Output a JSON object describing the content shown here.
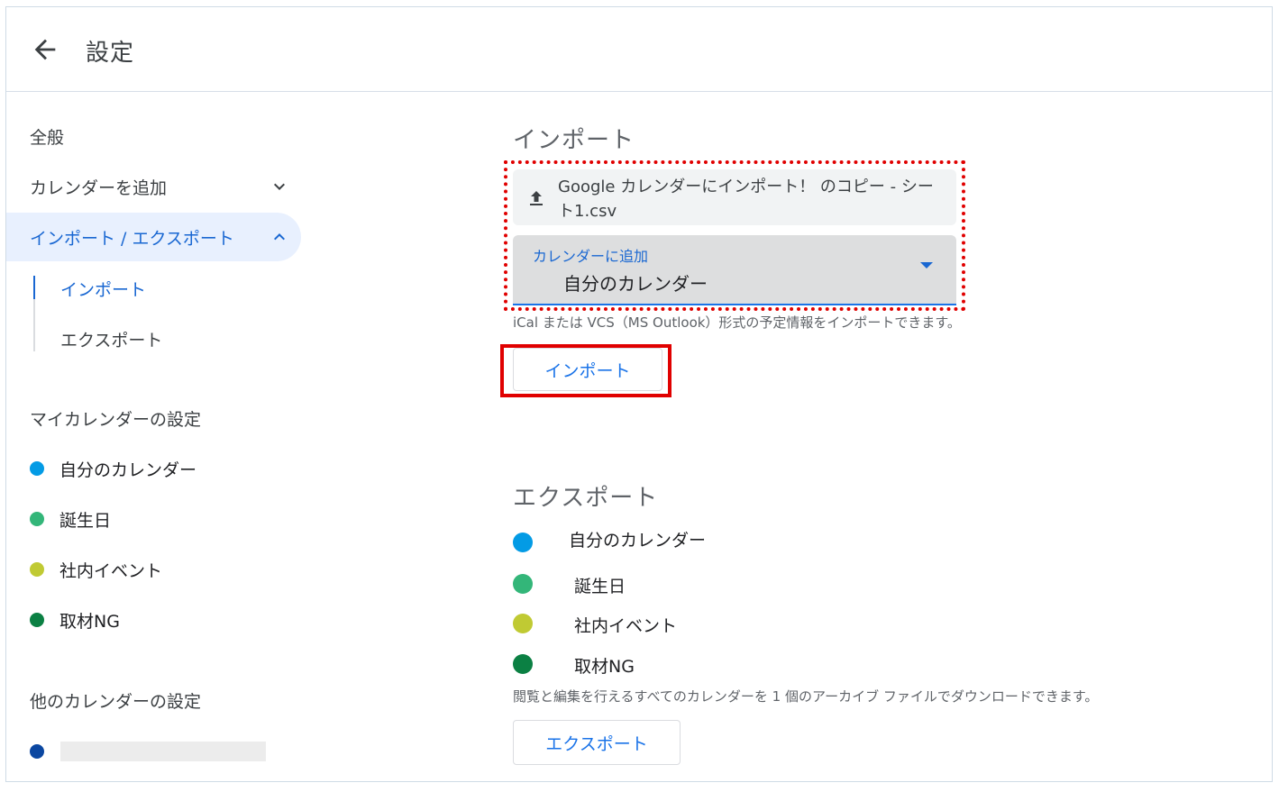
{
  "header": {
    "back_icon": "arrow-back-icon",
    "title": "設定"
  },
  "sidebar": {
    "general": "全般",
    "add_calendar": "カレンダーを追加",
    "import_export": "インポート / エクスポート",
    "sub_import": "インポート",
    "sub_export": "エクスポート",
    "my_calendars_title": "マイカレンダーの設定",
    "my_calendars": [
      {
        "label": "自分のカレンダー",
        "color": "#039be5"
      },
      {
        "label": "誕生日",
        "color": "#33b679"
      },
      {
        "label": "社内イベント",
        "color": "#c0ca33"
      },
      {
        "label": "取材NG",
        "color": "#0b8043"
      }
    ],
    "other_calendars_title": "他のカレンダーの設定",
    "other_calendar_color": "#0b47a1"
  },
  "import": {
    "title": "インポート",
    "file_name": "Google カレンダーにインポート！ のコピー - シート1.csv",
    "select_label": "カレンダーに追加",
    "select_value": "自分のカレンダー",
    "hint": "iCal または VCS（MS Outlook）形式の予定情報をインポートできます。",
    "button": "インポート"
  },
  "export": {
    "title": "エクスポート",
    "calendars": [
      {
        "label": "自分のカレンダー",
        "color": "#039be5"
      },
      {
        "label": "誕生日",
        "color": "#33b679"
      },
      {
        "label": "社内イベント",
        "color": "#c0ca33"
      },
      {
        "label": "取材NG",
        "color": "#0b8043"
      }
    ],
    "hint": "閲覧と編集を行えるすべてのカレンダーを 1 個のアーカイブ ファイルでダウンロードできます。",
    "button": "エクスポート"
  },
  "colors": {
    "accent": "#1a73e8",
    "highlight": "#e00000",
    "active_bg": "#e8f0fe"
  }
}
